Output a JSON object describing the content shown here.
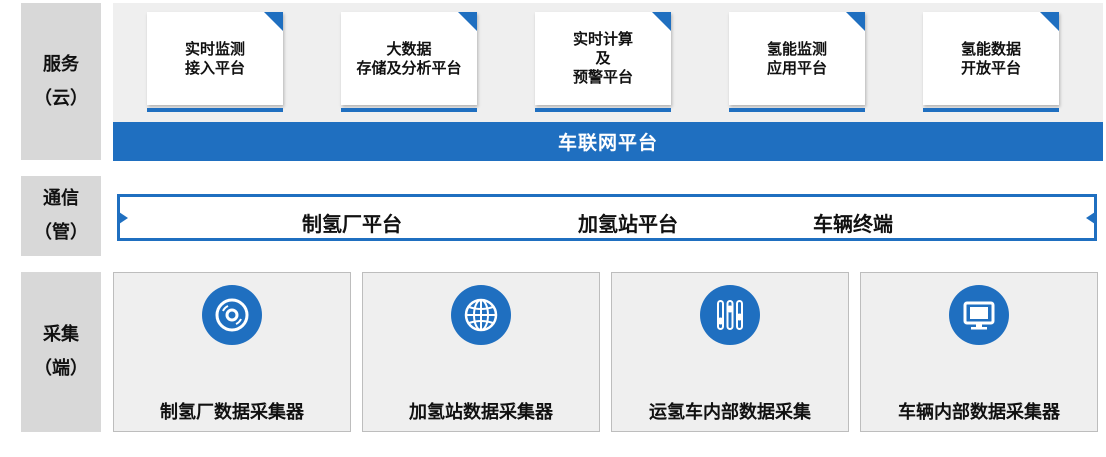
{
  "layers": {
    "service": {
      "line1": "服务",
      "line2": "（云）"
    },
    "comm": {
      "line1": "通信",
      "line2": "（管）"
    },
    "collect": {
      "line1": "采集",
      "line2": "（端）"
    }
  },
  "service_cards": [
    {
      "line1": "实时监测",
      "line2": "接入平台",
      "line3": ""
    },
    {
      "line1": "大数据",
      "line2": "存储及分析平台",
      "line3": ""
    },
    {
      "line1": "实时计算",
      "line2": "及",
      "line3": "预警平台"
    },
    {
      "line1": "氢能监测",
      "line2": "应用平台",
      "line3": ""
    },
    {
      "line1": "氢能数据",
      "line2": "开放平台",
      "line3": ""
    }
  ],
  "platform_bar": "车联网平台",
  "comm_items": [
    "制氢厂平台",
    "加氢站平台",
    "车辆终端"
  ],
  "collect_cards": [
    {
      "label": "制氢厂数据采集器",
      "icon": "disc-icon"
    },
    {
      "label": "加氢站数据采集器",
      "icon": "globe-icon"
    },
    {
      "label": "运氢车内部数据采集",
      "icon": "sliders-icon"
    },
    {
      "label": "车辆内部数据采集器",
      "icon": "monitor-icon"
    }
  ],
  "colors": {
    "accent": "#1f6fc0",
    "label_bg": "#d8d8d8",
    "panel_bg": "#efefef"
  }
}
